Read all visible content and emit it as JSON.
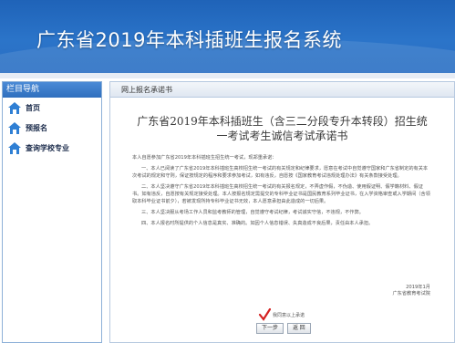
{
  "header": {
    "title": "广东省2019年本科插班生报名系统"
  },
  "sidebar": {
    "heading": "栏目导航",
    "items": [
      {
        "label": "首页"
      },
      {
        "label": "预报名"
      },
      {
        "label": "查询学校专业"
      }
    ]
  },
  "main": {
    "panel_title": "网上报名承诺书",
    "doc_title_line1": "广东省2019年本科插班生（含三二分段专升本转段）招生统",
    "doc_title_line2": "一考试考生诚信考试承诺书",
    "paragraphs": [
      "本人自愿参加广东省2019年本科插班生招生统一考试，现郑重承诺：",
      "一、本人已阅读了广东省2019年本科插班生高校招生统一考试的有关规定和纪律要求，愿意在考试中自觉遵守国家和广东省制定的有关本次考试的规定和守则，保证按规定的程序和要求参加考试，如有违反，自愿按《国家教育考试违规处理办法》有关条款接受处理。",
      "二、本人坚决遵守广东省2019年本科插班生高校招生统一考试的有关报名规定，不弄虚作假，不伪造、使用假证明、假学籍材料、假证书。如有违反，自愿按有关规定接受处理。本人按报名规定需提交的专科毕业证书是国民教育系列毕业证书，在入学资格审查或入学期间（含领取本科毕业证书前夕），若被发现所持专科毕业证书无效，本人愿意承担由此造成的一切后果。",
      "三、本人坚决服从考场工作人员和监考教师的管理，自觉遵守考试纪律，考试诚实守信，不违规，不作弊。",
      "四、本人报名时所提供的个人信息是真实、准确的。如因个人信息错误、失真造成不良后果，责任由本人承担。"
    ],
    "sign_date": "2019年1月",
    "sign_org": "广东省教育考试院",
    "agree_label": "我同意以上承诺",
    "next_button": "下一步",
    "back_button": "返 回"
  },
  "colors": {
    "banner": "#2b74c9",
    "accent": "#2f6fbe"
  }
}
